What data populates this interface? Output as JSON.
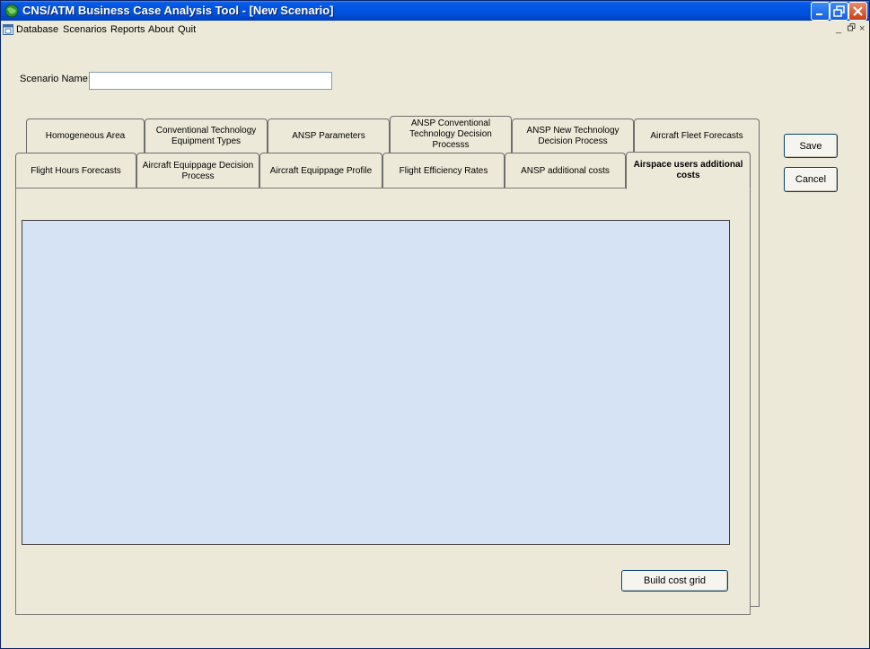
{
  "window": {
    "title": "CNS/ATM Business Case Analysis Tool - [New Scenario]",
    "controls": {
      "minimize": "–",
      "maximize": "□",
      "close": "✕"
    }
  },
  "menubar": {
    "items": [
      "Database",
      "Scenarios",
      "Reports",
      "About",
      "Quit"
    ],
    "mdi_controls": {
      "minimize": "_",
      "restore": "ð",
      "close": "×"
    }
  },
  "form": {
    "scenario_name_label": "Scenario Name:",
    "scenario_name_value": ""
  },
  "tabs_row1": [
    "Homogeneous Area",
    "Conventional Technology Equipment Types",
    "ANSP Parameters",
    "ANSP Conventional Technology Decision Processs",
    "ANSP New Technology Decision Process",
    "Aircraft Fleet Forecasts"
  ],
  "tabs_row2": [
    "Flight Hours Forecasts",
    "Aircraft Equippage Decision Process",
    "Aircraft Equippage Profile",
    "Flight Efficiency Rates",
    "ANSP additional costs",
    "Airspace users additional costs"
  ],
  "active_tab": "Airspace users additional costs",
  "buttons": {
    "save": "Save",
    "cancel": "Cancel",
    "build_cost_grid": "Build cost grid"
  },
  "colors": {
    "title_bar": "#0054e3",
    "grid_background": "#d6e3f5",
    "window_background": "#ece9d8"
  }
}
